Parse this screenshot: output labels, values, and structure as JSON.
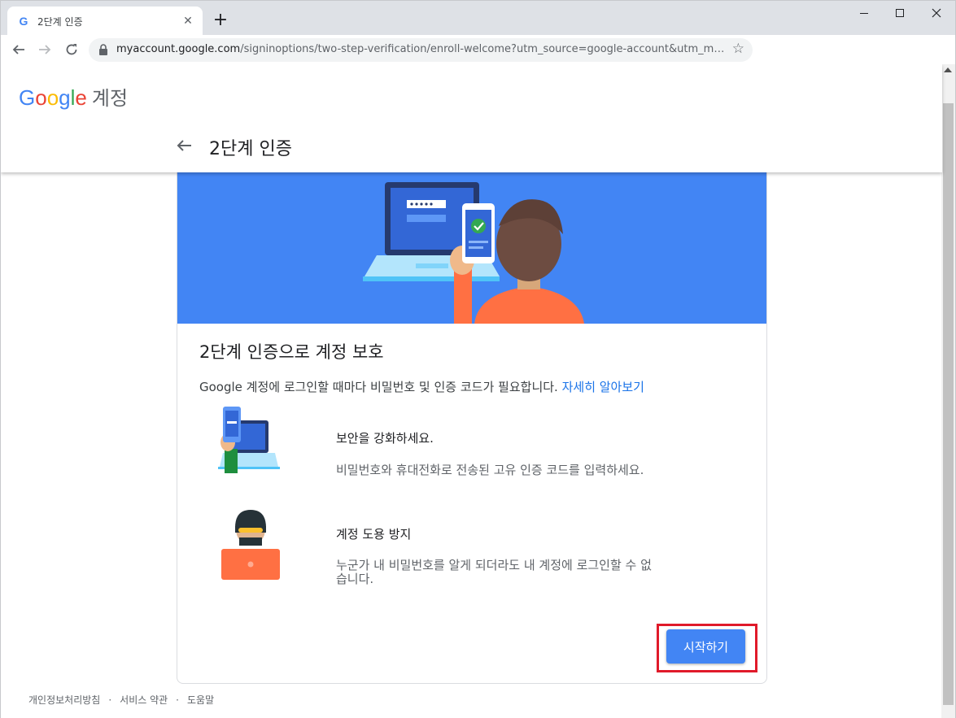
{
  "browser": {
    "tab_title": "2단계 인증",
    "tab_favicon": "G",
    "new_tab": "+",
    "tab_close": "✕",
    "url_host": "myaccount.google.com",
    "url_path": "/signinoptions/two-step-verification/enroll-welcome?utm_source=google-account&utm_me..."
  },
  "header": {
    "brand_letters": [
      "G",
      "o",
      "o",
      "g",
      "l",
      "e"
    ],
    "brand_suffix": "계정",
    "page_title": "2단계 인증"
  },
  "card": {
    "heading": "2단계 인증으로 계정 보호",
    "description": "Google 계정에 로그인할 때마다 비밀번호 및 인증 코드가 필요합니다. ",
    "learn_more": "자세히 알아보기",
    "features": [
      {
        "title": "보안을 강화하세요.",
        "desc": "비밀번호와 휴대전화로 전송된 고유 인증 코드를 입력하세요."
      },
      {
        "title": "계정 도용 방지",
        "desc": "누군가 내 비밀번호를 알게 되더라도 내 계정에 로그인할 수 없습니다."
      }
    ],
    "start_button": "시작하기"
  },
  "footer": {
    "links": [
      "개인정보처리방침",
      "서비스 약관",
      "도움말"
    ],
    "separator": "·"
  },
  "colors": {
    "accent": "#4285f4",
    "link": "#1a73e8",
    "highlight": "#e01a2a"
  }
}
